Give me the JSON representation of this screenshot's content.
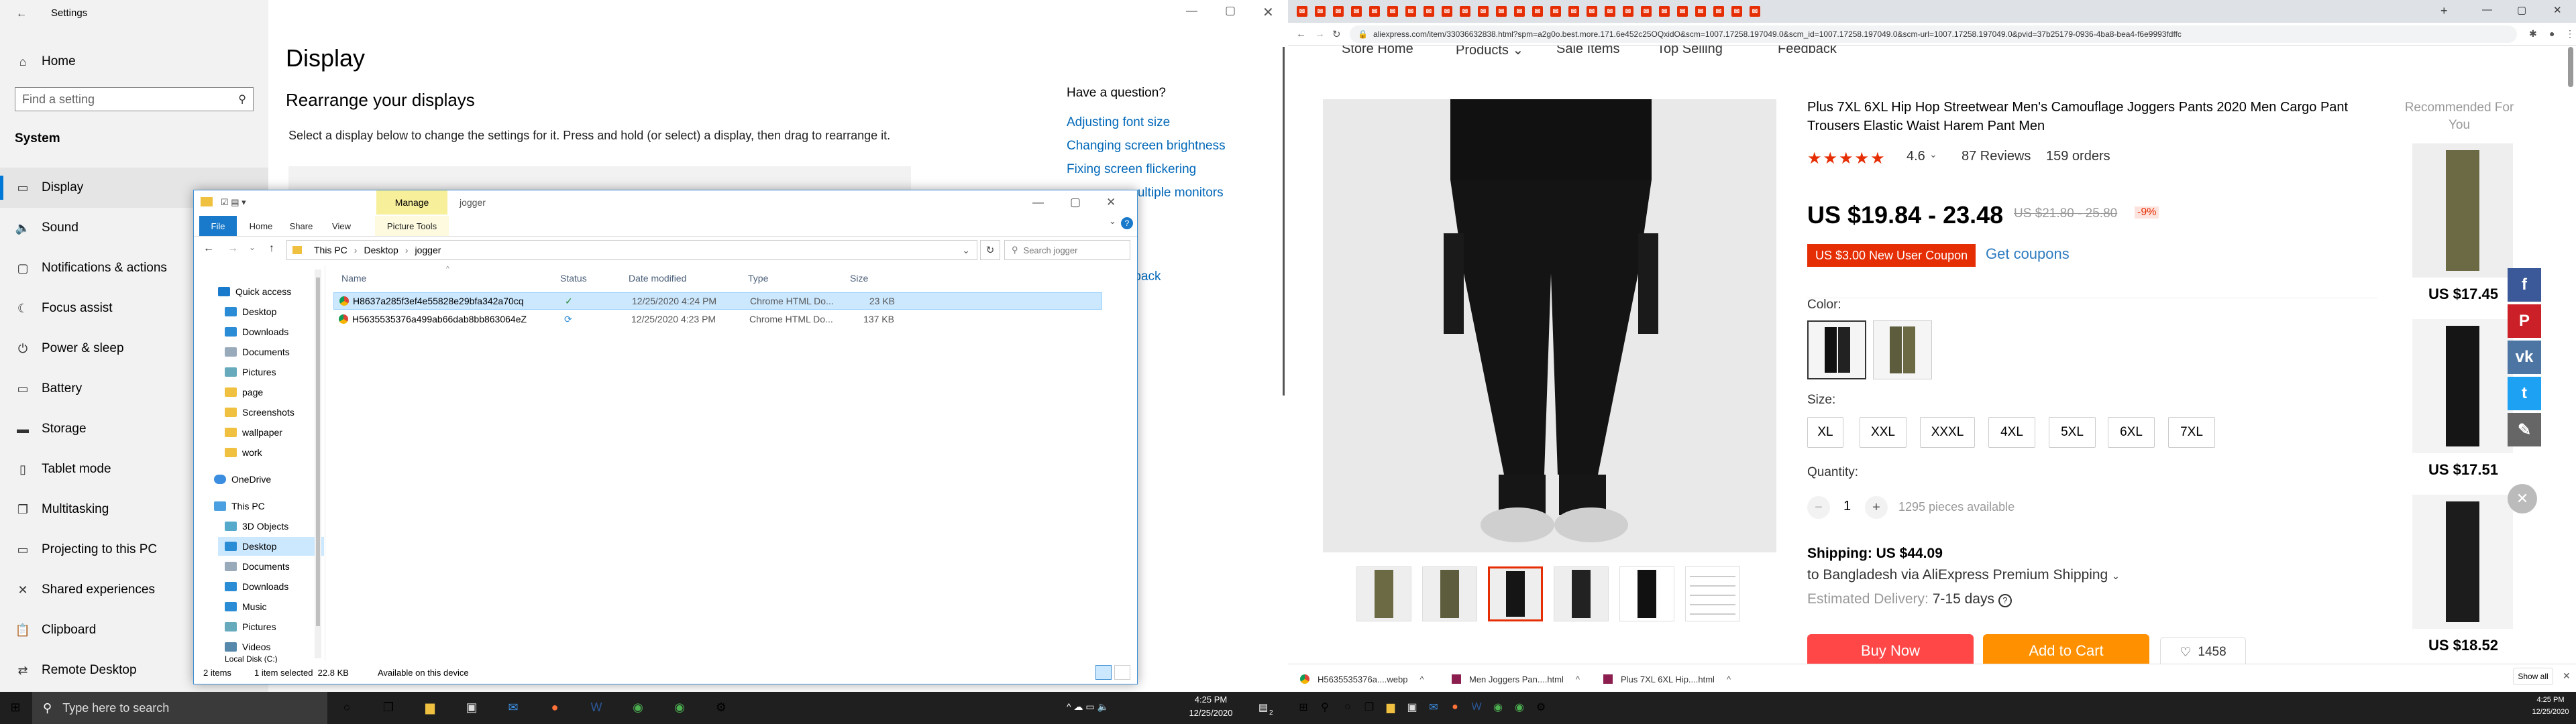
{
  "settings": {
    "app_title": "Settings",
    "home": "Home",
    "search_placeholder": "Find a setting",
    "section": "System",
    "nav": [
      "Display",
      "Sound",
      "Notifications & actions",
      "Focus assist",
      "Power & sleep",
      "Battery",
      "Storage",
      "Tablet mode",
      "Multitasking",
      "Projecting to this PC",
      "Shared experiences",
      "Clipboard",
      "Remote Desktop"
    ],
    "page_title": "Display",
    "heading": "Rearrange your displays",
    "desc": "Select a display below to change the settings for it. Press and hold (or select) a display, then drag to rearrange it.",
    "question": "Have a question?",
    "links": [
      "Adjusting font size",
      "Changing screen brightness",
      "Fixing screen flickering",
      "...ultiple monitors",
      "...dback"
    ]
  },
  "explorer": {
    "manage": "Manage",
    "folder": "jogger",
    "tabs": [
      "File",
      "Home",
      "Share",
      "View",
      "Picture Tools"
    ],
    "breadcrumb": [
      "This PC",
      "Desktop",
      "jogger"
    ],
    "search_placeholder": "Search jogger",
    "tree": [
      "Quick access",
      "Desktop",
      "Downloads",
      "Documents",
      "Pictures",
      "page",
      "Screenshots",
      "wallpaper",
      "work",
      "OneDrive",
      "This PC",
      "3D Objects",
      "Desktop",
      "Documents",
      "Downloads",
      "Music",
      "Pictures",
      "Videos",
      "Local Disk (C:)"
    ],
    "columns": [
      "Name",
      "Status",
      "Date modified",
      "Type",
      "Size"
    ],
    "files": [
      {
        "name": "H8637a285f3ef4e55828e29bfa342a70cq",
        "date": "12/25/2020 4:24 PM",
        "type": "Chrome HTML Do...",
        "size": "23 KB"
      },
      {
        "name": "H5635535376a499ab66dab8bb863064eZ",
        "date": "12/25/2020 4:23 PM",
        "type": "Chrome HTML Do...",
        "size": "137 KB"
      }
    ],
    "status": {
      "items": "2 items",
      "selected": "1 item selected  22.8 KB",
      "device": "Available on this device"
    }
  },
  "browser": {
    "url": "aliexpress.com/item/33036632838.html?spm=a2g0o.best.more.171.6e452c25OQxidO&scm=1007.17258.197049.0&scm_id=1007.17258.197049.0&scm-url=1007.17258.197049.0&pvid=37b25179-0936-4ba8-bea4-f6e9993fdffc",
    "nav_links": [
      "Store Home",
      "Products ⌄",
      "Sale Items",
      "Top Selling",
      "Feedback"
    ],
    "title": "Plus 7XL 6XL Hip Hop Streetwear Men's Camouflage Joggers Pants 2020 Men Cargo Pant Trousers Elastic Waist Harem Pant Men",
    "rating": "4.6",
    "reviews": "87 Reviews",
    "orders": "159 orders",
    "price": "US $19.84 - 23.48",
    "old_price": "US $21.80 - 25.80",
    "discount": "-9%",
    "coupon": "US $3.00 New User Coupon",
    "get_coupons": "Get coupons",
    "color_label": "Color:",
    "size_label": "Size:",
    "sizes": [
      "XL",
      "XXL",
      "XXXL",
      "4XL",
      "5XL",
      "6XL",
      "7XL"
    ],
    "quantity_label": "Quantity:",
    "quantity": "1",
    "available": "1295 pieces available",
    "shipping": "Shipping: US $44.09",
    "shipping_to": "to Bangladesh via AliExpress Premium Shipping",
    "delivery_label": "Estimated Delivery:",
    "delivery": "7-15 days",
    "buy": "Buy Now",
    "cart": "Add to Cart",
    "wish": "1458",
    "recommended": "Recommended For You",
    "rec_prices": [
      "US $17.45",
      "US $17.51",
      "US $18.52"
    ],
    "downloads": [
      "H5635535376a....webp",
      "Men Joggers Pan....html",
      "Plus 7XL 6XL Hip....html"
    ],
    "show_all": "Show all",
    "accent": "#e62e04"
  },
  "taskbar": {
    "search": "Type here to search",
    "time_left": "4:25 PM",
    "date_left": "12/25/2020",
    "badge": "2",
    "time_right": "4:25 PM",
    "date_right": "12/25/2020"
  }
}
